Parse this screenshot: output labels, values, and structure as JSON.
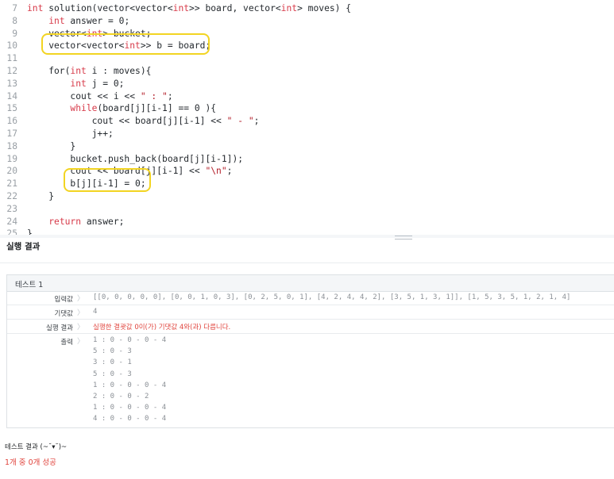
{
  "editor": {
    "lines": [
      {
        "n": "7",
        "tokens": [
          [
            "int",
            "kw"
          ],
          [
            " solution(vector<vector<",
            ""
          ],
          [
            "int",
            "kw"
          ],
          [
            ">> board, vector<",
            ""
          ],
          [
            "int",
            "kw"
          ],
          [
            "> moves) {",
            ""
          ]
        ]
      },
      {
        "n": "8",
        "tokens": [
          [
            "    ",
            ""
          ],
          [
            "int",
            "kw"
          ],
          [
            " answer = 0;",
            ""
          ]
        ]
      },
      {
        "n": "9",
        "tokens": [
          [
            "    vector<",
            ""
          ],
          [
            "int",
            "kw"
          ],
          [
            "> bucket;",
            ""
          ]
        ]
      },
      {
        "n": "10",
        "tokens": [
          [
            "    vector<vector<",
            ""
          ],
          [
            "int",
            "kw"
          ],
          [
            ">> b = board;",
            ""
          ]
        ]
      },
      {
        "n": "11",
        "tokens": []
      },
      {
        "n": "12",
        "tokens": [
          [
            "    for(",
            ""
          ],
          [
            "int",
            "kw"
          ],
          [
            " i : moves){",
            ""
          ]
        ]
      },
      {
        "n": "13",
        "tokens": [
          [
            "        ",
            ""
          ],
          [
            "int",
            "kw"
          ],
          [
            " j = 0;",
            ""
          ]
        ]
      },
      {
        "n": "14",
        "tokens": [
          [
            "        cout << i << ",
            ""
          ],
          [
            "\" : \"",
            "str"
          ],
          [
            ";",
            ""
          ]
        ]
      },
      {
        "n": "15",
        "tokens": [
          [
            "        ",
            ""
          ],
          [
            "while",
            "kw"
          ],
          [
            "(board[j][i-1] == 0 ){",
            ""
          ]
        ]
      },
      {
        "n": "16",
        "tokens": [
          [
            "            cout << board[j][i-1] << ",
            ""
          ],
          [
            "\" - \"",
            "str"
          ],
          [
            ";",
            ""
          ]
        ]
      },
      {
        "n": "17",
        "tokens": [
          [
            "            j++;",
            ""
          ]
        ]
      },
      {
        "n": "18",
        "tokens": [
          [
            "        }",
            ""
          ]
        ]
      },
      {
        "n": "19",
        "tokens": [
          [
            "        bucket.push_back(board[j][i-1]);",
            ""
          ]
        ]
      },
      {
        "n": "20",
        "tokens": [
          [
            "        cout << board[j][i-1] << ",
            ""
          ],
          [
            "\"\\n\"",
            "str"
          ],
          [
            ";",
            ""
          ]
        ]
      },
      {
        "n": "21",
        "tokens": [
          [
            "        b[j][i-1] = 0;",
            ""
          ]
        ]
      },
      {
        "n": "22",
        "tokens": [
          [
            "    }",
            ""
          ]
        ]
      },
      {
        "n": "23",
        "tokens": []
      },
      {
        "n": "24",
        "tokens": [
          [
            "    ",
            ""
          ],
          [
            "return",
            "kw"
          ],
          [
            " answer;",
            ""
          ]
        ]
      },
      {
        "n": "25",
        "tokens": [
          [
            "}",
            ""
          ]
        ]
      }
    ]
  },
  "result": {
    "title": "실행 결과",
    "test_name": "테스트 1",
    "rows": [
      {
        "label": "입력값",
        "sep": "〉",
        "value": "[[0, 0, 0, 0, 0], [0, 0, 1, 0, 3], [0, 2, 5, 0, 1], [4, 2, 4, 4, 2], [3, 5, 1, 3, 1]], [1, 5, 3, 5, 1, 2, 1, 4]",
        "error": false
      },
      {
        "label": "기댓값",
        "sep": "〉",
        "value": "4",
        "error": false
      },
      {
        "label": "실행 결과",
        "sep": "〉",
        "value": "실행한 결괏값 0이(가) 기댓값 4와(과) 다릅니다.",
        "error": true
      }
    ],
    "output_label": "출력",
    "output_sep": "〉",
    "output_lines": [
      "1 : 0 - 0 - 0 - 4",
      "5 : 0 - 3",
      "3 : 0 - 1",
      "5 : 0 - 3",
      "1 : 0 - 0 - 0 - 4",
      "2 : 0 - 0 - 2",
      "1 : 0 - 0 - 0 - 4",
      "4 : 0 - 0 - 0 - 4"
    ],
    "summary_title": "테스트 결과 (~˘▾˘)~",
    "summary_text": "1개 중 0개 성공"
  },
  "colors": {
    "keyword": "#d73a49",
    "string": "#b31d28",
    "error": "#e0443d",
    "highlight": "#f2d422"
  }
}
